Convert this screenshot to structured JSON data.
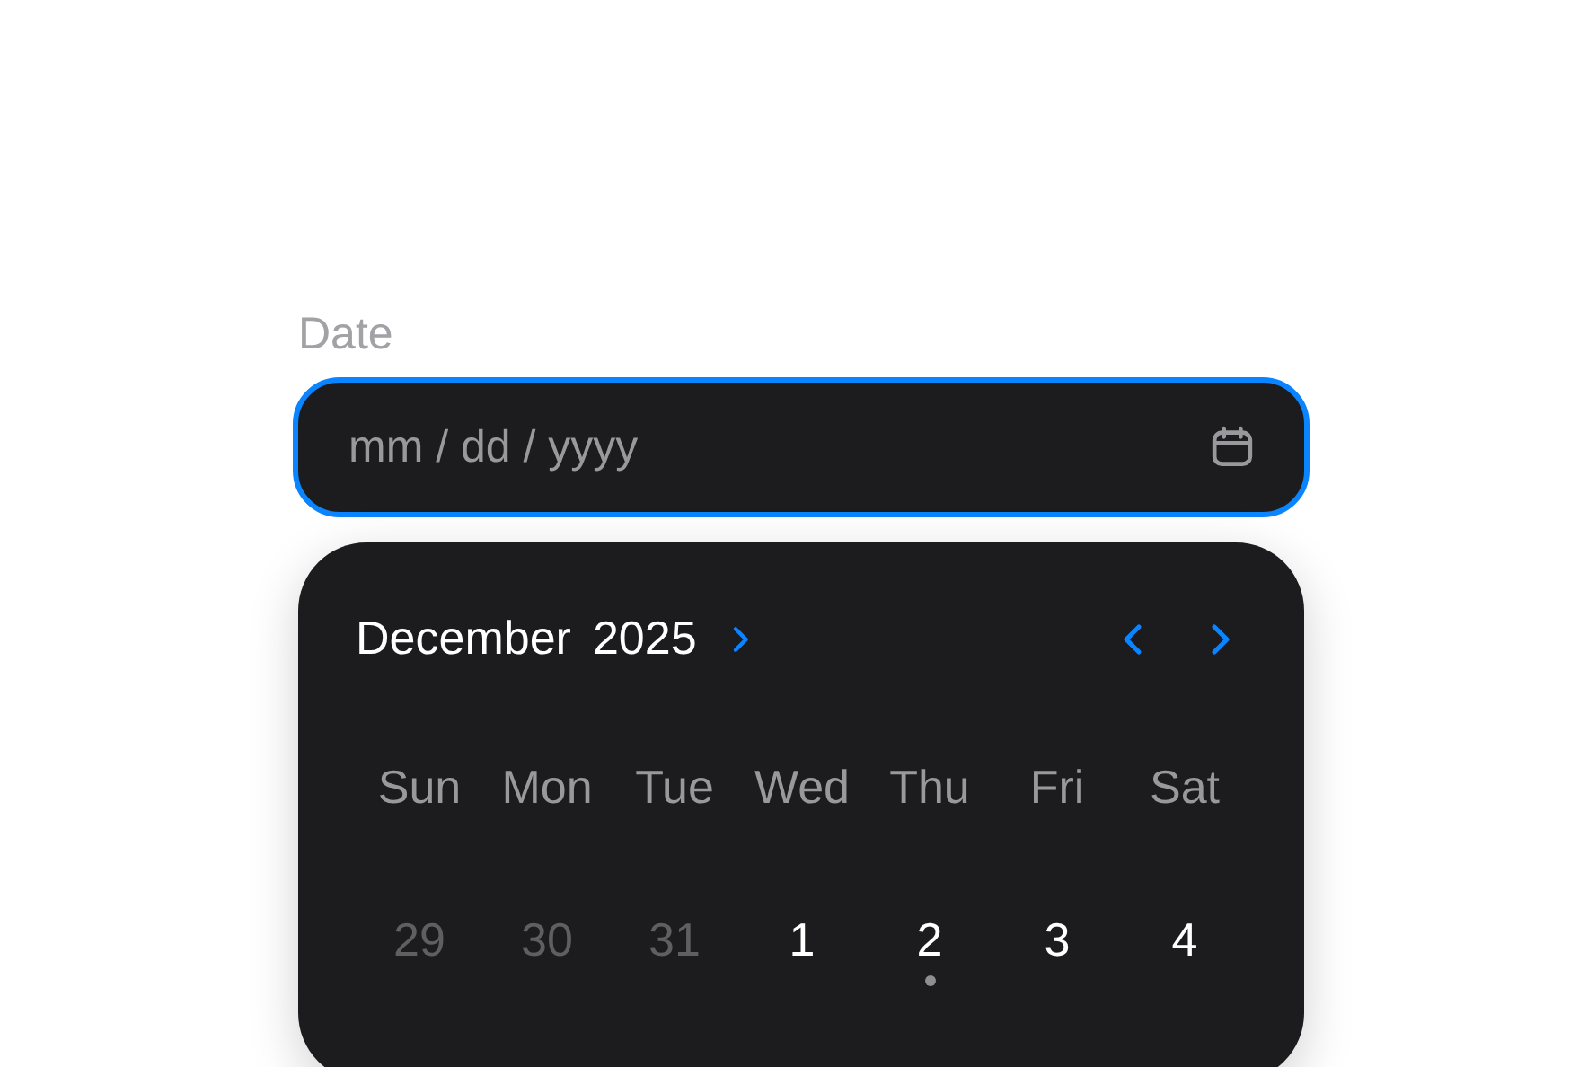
{
  "label": "Date",
  "field": {
    "placeholder": "mm / dd / yyyy",
    "focused": true
  },
  "calendar": {
    "month": "December",
    "year": "2025",
    "weekdays": [
      "Sun",
      "Mon",
      "Tue",
      "Wed",
      "Thu",
      "Fri",
      "Sat"
    ],
    "days": [
      {
        "label": "29",
        "outside_month": true,
        "marked": false
      },
      {
        "label": "30",
        "outside_month": true,
        "marked": false
      },
      {
        "label": "31",
        "outside_month": true,
        "marked": false
      },
      {
        "label": "1",
        "outside_month": false,
        "marked": false
      },
      {
        "label": "2",
        "outside_month": false,
        "marked": true
      },
      {
        "label": "3",
        "outside_month": false,
        "marked": false
      },
      {
        "label": "4",
        "outside_month": false,
        "marked": false
      }
    ]
  }
}
